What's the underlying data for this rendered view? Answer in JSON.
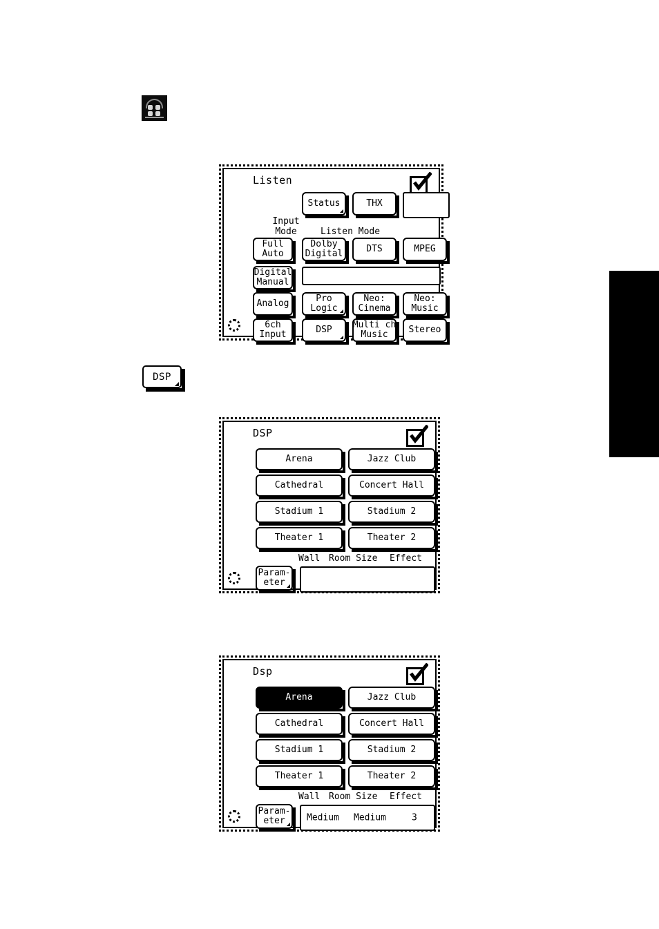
{
  "page": {
    "step_icon_name": "speaker-grid-icon",
    "tab_marker_color": "#000000"
  },
  "standalone_keys": [
    {
      "label": "DSP",
      "name": "dsp-key",
      "has_submenu_marker": true
    }
  ],
  "panels": [
    {
      "name": "listen-panel",
      "title": "Listen",
      "check_icon": "checkmark-icon",
      "status_circle_icon": "dotted-circle-icon",
      "group_labels": [
        {
          "text": "Input\nMode",
          "name": "input-mode-label"
        },
        {
          "text": "Listen Mode",
          "name": "listen-mode-label"
        }
      ],
      "top_row": [
        {
          "label": "Status",
          "name": "status-button",
          "submenu": true
        },
        {
          "label": "THX",
          "name": "thx-button",
          "submenu": false
        },
        {
          "label": "",
          "name": "empty-slot-button",
          "submenu": false,
          "flat": true
        }
      ],
      "input_mode_buttons": [
        {
          "label": "Full\nAuto",
          "name": "input-mode-full-auto"
        },
        {
          "label": "Digital\nManual",
          "name": "input-mode-digital-manual"
        },
        {
          "label": "Analog",
          "name": "input-mode-analog"
        },
        {
          "label": "6ch\nInput",
          "name": "input-mode-6ch-input"
        }
      ],
      "listen_mode_buttons": [
        {
          "label": "Dolby\nDigital",
          "name": "listen-mode-dolby-digital",
          "submenu": false
        },
        {
          "label": "DTS",
          "name": "listen-mode-dts",
          "submenu": false
        },
        {
          "label": "MPEG",
          "name": "listen-mode-mpeg",
          "submenu": false
        },
        {
          "label": "Pro\nLogic",
          "name": "listen-mode-pro-logic",
          "submenu": true
        },
        {
          "label": "Neo:\nCinema",
          "name": "listen-mode-neo-cinema",
          "submenu": false
        },
        {
          "label": "Neo:\nMusic",
          "name": "listen-mode-neo-music",
          "submenu": false
        },
        {
          "label": "DSP",
          "name": "listen-mode-dsp",
          "submenu": true
        },
        {
          "label": "Multi ch\nMusic",
          "name": "listen-mode-multi-ch-music",
          "submenu": false
        },
        {
          "label": "Stereo",
          "name": "listen-mode-stereo",
          "submenu": false
        }
      ],
      "display_strip": {
        "value": "",
        "name": "listen-mode-readout"
      }
    },
    {
      "name": "dsp-panel-unselected",
      "title": "DSP",
      "check_icon": "checkmark-icon",
      "status_circle_icon": "dotted-circle-icon",
      "mode_buttons": [
        {
          "label": "Arena",
          "name": "dsp-mode-arena",
          "selected": false
        },
        {
          "label": "Jazz Club",
          "name": "dsp-mode-jazz-club",
          "selected": false
        },
        {
          "label": "Cathedral",
          "name": "dsp-mode-cathedral",
          "selected": false
        },
        {
          "label": "Concert Hall",
          "name": "dsp-mode-concert-hall",
          "selected": false
        },
        {
          "label": "Stadium 1",
          "name": "dsp-mode-stadium-1",
          "selected": false
        },
        {
          "label": "Stadium 2",
          "name": "dsp-mode-stadium-2",
          "selected": false
        },
        {
          "label": "Theater 1",
          "name": "dsp-mode-theater-1",
          "selected": false
        },
        {
          "label": "Theater 2",
          "name": "dsp-mode-theater-2",
          "selected": false
        }
      ],
      "parameter_button": {
        "label": "Param-\neter",
        "name": "parameter-button",
        "submenu": true
      },
      "column_headers": [
        {
          "text": "Wall",
          "name": "wall-header"
        },
        {
          "text": "Room Size",
          "name": "room-size-header"
        },
        {
          "text": "Effect",
          "name": "effect-header"
        }
      ],
      "values": [
        {
          "text": "",
          "name": "wall-value"
        },
        {
          "text": "",
          "name": "room-size-value"
        },
        {
          "text": "",
          "name": "effect-value"
        }
      ]
    },
    {
      "name": "dsp-panel-selected",
      "title": "Dsp",
      "check_icon": "checkmark-icon",
      "status_circle_icon": "dotted-circle-icon",
      "mode_buttons": [
        {
          "label": "Arena",
          "name": "dsp-mode-arena",
          "selected": true
        },
        {
          "label": "Jazz Club",
          "name": "dsp-mode-jazz-club",
          "selected": false
        },
        {
          "label": "Cathedral",
          "name": "dsp-mode-cathedral",
          "selected": false
        },
        {
          "label": "Concert Hall",
          "name": "dsp-mode-concert-hall",
          "selected": false
        },
        {
          "label": "Stadium 1",
          "name": "dsp-mode-stadium-1",
          "selected": false
        },
        {
          "label": "Stadium 2",
          "name": "dsp-mode-stadium-2",
          "selected": false
        },
        {
          "label": "Theater 1",
          "name": "dsp-mode-theater-1",
          "selected": false
        },
        {
          "label": "Theater 2",
          "name": "dsp-mode-theater-2",
          "selected": false
        }
      ],
      "parameter_button": {
        "label": "Param-\neter",
        "name": "parameter-button",
        "submenu": true
      },
      "column_headers": [
        {
          "text": "Wall",
          "name": "wall-header"
        },
        {
          "text": "Room Size",
          "name": "room-size-header"
        },
        {
          "text": "Effect",
          "name": "effect-header"
        }
      ],
      "values": [
        {
          "text": "Medium",
          "name": "wall-value"
        },
        {
          "text": "Medium",
          "name": "room-size-value"
        },
        {
          "text": "3",
          "name": "effect-value"
        }
      ]
    }
  ]
}
